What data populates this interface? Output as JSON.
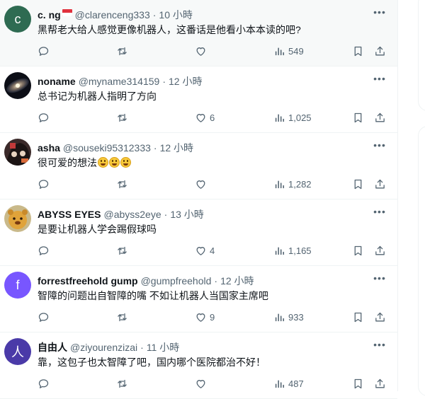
{
  "tweets": [
    {
      "name": "c. ng",
      "handle": "@clarenceng333",
      "time": "10 小時",
      "text": "黑帮老大给人感觉更像机器人，这番话是他看小本本读的吧?",
      "avatar": {
        "kind": "letter",
        "letter": "c",
        "bg": "#2e6b52"
      },
      "has_flag": true,
      "reply_count": "",
      "retweet_count": "",
      "like_count": "",
      "view_count": "549",
      "highlighted": true
    },
    {
      "name": "noname",
      "handle": "@myname314159",
      "time": "12 小時",
      "text": "总书记为机器人指明了方向",
      "avatar": {
        "kind": "image",
        "style": "galaxy"
      },
      "has_flag": false,
      "reply_count": "",
      "retweet_count": "",
      "like_count": "6",
      "view_count": "1,025",
      "highlighted": false
    },
    {
      "name": "asha",
      "handle": "@souseki95312333",
      "time": "12 小時",
      "text": "很可爱的想法",
      "emoji_count": 3,
      "avatar": {
        "kind": "image",
        "style": "cartoon"
      },
      "has_flag": false,
      "reply_count": "",
      "retweet_count": "",
      "like_count": "",
      "view_count": "1,282",
      "highlighted": false
    },
    {
      "name": "ABYSS EYES",
      "handle": "@abyss2eye",
      "time": "13 小時",
      "text": "是要让机器人学会踢假球吗",
      "avatar": {
        "kind": "image",
        "style": "bear"
      },
      "has_flag": false,
      "reply_count": "",
      "retweet_count": "",
      "like_count": "4",
      "view_count": "1,165",
      "highlighted": false
    },
    {
      "name": "forrestfreehold gump",
      "handle": "@gumpfreehold",
      "time": "12 小時",
      "text": "智障的问题出自智障的嘴 不如让机器人当国家主席吧",
      "avatar": {
        "kind": "letter",
        "letter": "f",
        "bg": "#7856ff"
      },
      "has_flag": false,
      "reply_count": "",
      "retweet_count": "",
      "like_count": "9",
      "view_count": "933",
      "highlighted": false
    },
    {
      "name": "自由人",
      "handle": "@ziyourenzizai",
      "time": "11 小時",
      "text": "靠，这包子也太智障了吧，国内哪个医院都治不好！",
      "avatar": {
        "kind": "letter",
        "letter": "人",
        "bg": "#4a3aa8"
      },
      "has_flag": false,
      "reply_count": "",
      "retweet_count": "",
      "like_count": "",
      "view_count": "487",
      "highlighted": false
    }
  ],
  "icons": {
    "reply": "reply-icon",
    "retweet": "retweet-icon",
    "like": "like-icon",
    "views": "views-icon",
    "bookmark": "bookmark-icon",
    "share": "share-icon",
    "more": "more-icon"
  },
  "colors": {
    "text": "#0f1419",
    "muted": "#536471",
    "border": "#eff3f4",
    "highlight_bg": "#f7f9f9"
  }
}
